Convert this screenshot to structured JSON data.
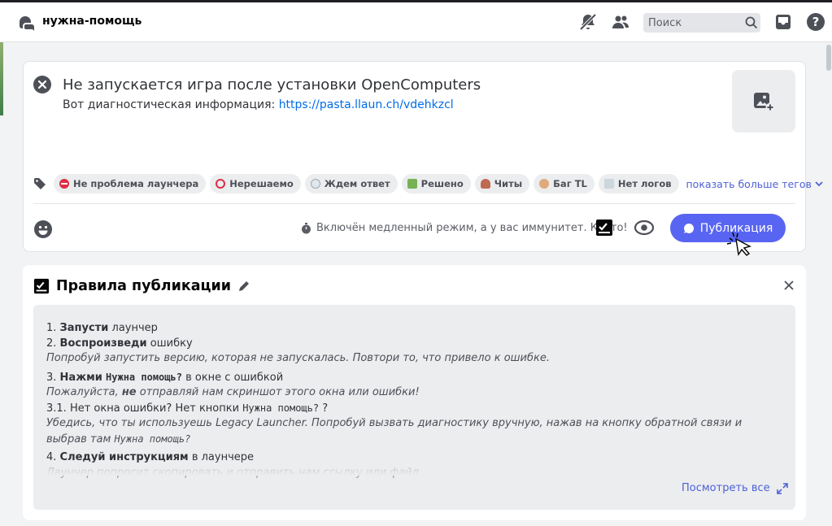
{
  "header": {
    "channel_name": "нужна-помощь",
    "search_placeholder": "Поиск",
    "icons": [
      "forum-channel-icon",
      "notifications-muted-icon",
      "members-icon",
      "search-icon",
      "inbox-icon",
      "help-icon"
    ]
  },
  "composer": {
    "title": "Не запускается игра после установки OpenComputers",
    "body_prefix": "Вот диагностическая информация: ",
    "body_link": "https://pasta.llaun.ch/vdehkzcl",
    "tags": [
      {
        "label": "Не проблема лаунчера",
        "emoji": "no-entry"
      },
      {
        "label": "Нерешаемо",
        "emoji": "prohibited"
      },
      {
        "label": "Ждем ответ",
        "emoji": "clock"
      },
      {
        "label": "Решено",
        "emoji": "check-mark"
      },
      {
        "label": "Читы",
        "emoji": "poop"
      },
      {
        "label": "Баг TL",
        "emoji": "face"
      },
      {
        "label": "Нет логов",
        "emoji": "empty-box"
      }
    ],
    "more_tags_label": "показать больше тегов",
    "slowmode_text": "Включён медленный режим, а у вас иммунитет. Круто!",
    "publish_label": "Публикация"
  },
  "rules": {
    "title": "Правила публикации",
    "line1_bold": "Запусти",
    "line1_rest": " лаунчер",
    "line2_bold": "Воспроизведи",
    "line2_rest": " ошибку",
    "line2_note": "Попробуй запустить версию, которая не запускалась. Повтори то, что привело к ошибке.",
    "line3_bold": "Нажми",
    "line3_code": "Нужна помощь?",
    "line3_rest": " в окне с ошибкой",
    "line3_note_a": "Пожалуйста, ",
    "line3_note_b": "не",
    "line3_note_c": " отправляй нам скриншот этого окна или ошибки!",
    "line31_text": "3.1. Нет окна ошибки? Нет кнопки ",
    "line31_code": "Нужна помощь?",
    "line31_end": " ?",
    "line31_note": "Убедись, что ты используешь Legacy Launcher. Попробуй вызвать диагностику вручную, нажав на кнопку обратной связи и выбрав там ",
    "line31_note_code": "Нужна помощь?",
    "line4_bold": "Следуй инструкциям",
    "line4_rest": " в лаунчере",
    "line4_note": "Лаунчер попросит скопировать и отправить нам ссылку или файл.",
    "see_all_label": "Посмотреть все"
  },
  "colors": {
    "accent": "#5865f2",
    "link": "#006ce7",
    "text": "#313338",
    "muted": "#5c5e66"
  }
}
